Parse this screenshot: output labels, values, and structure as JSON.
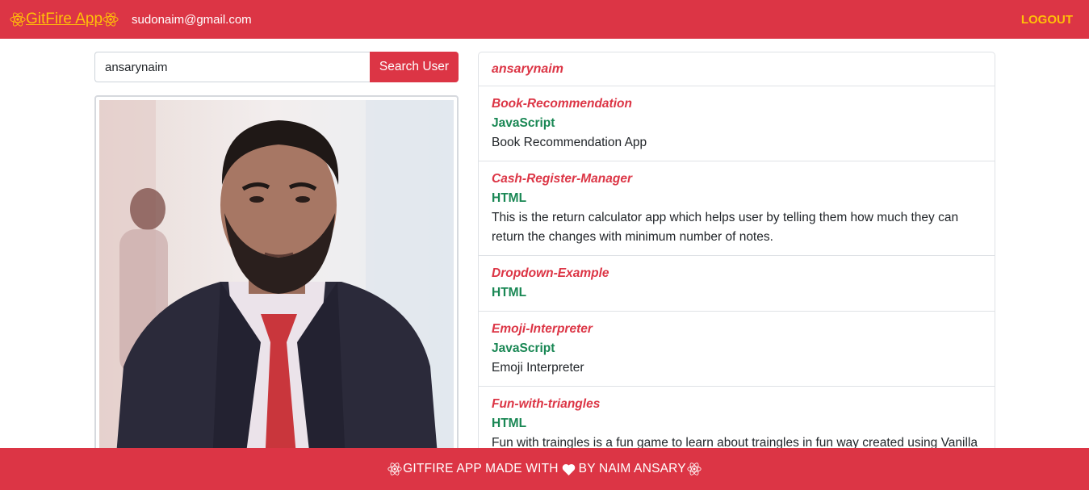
{
  "navbar": {
    "brand": "GitFire App",
    "email": "sudonaim@gmail.com",
    "logout": "LOGOUT"
  },
  "search": {
    "value": "ansarynaim",
    "button": "Search User"
  },
  "profile": {
    "avatar_icon": "user-photo"
  },
  "repos": {
    "username": "ansarynaim",
    "items": [
      {
        "name": "Book-Recommendation",
        "language": "JavaScript",
        "description": "Book Recommendation App"
      },
      {
        "name": "Cash-Register-Manager",
        "language": "HTML",
        "description": "This is the return calculator app which helps user by telling them how much they can return the changes with minimum number of notes."
      },
      {
        "name": "Dropdown-Example",
        "language": "HTML",
        "description": ""
      },
      {
        "name": "Emoji-Interpreter",
        "language": "JavaScript",
        "description": "Emoji Interpreter"
      },
      {
        "name": "Fun-with-triangles",
        "language": "HTML",
        "description": "Fun with traingles is a fun game to learn about traingles in fun way created using Vanilla JS and it has four sections"
      }
    ]
  },
  "footer": {
    "text_before": "GITFIRE APP MADE WITH",
    "text_after": "BY NAIM ANSARY"
  },
  "colors": {
    "primary": "#dc3545",
    "accent": "#ffc107",
    "language": "#198754"
  }
}
